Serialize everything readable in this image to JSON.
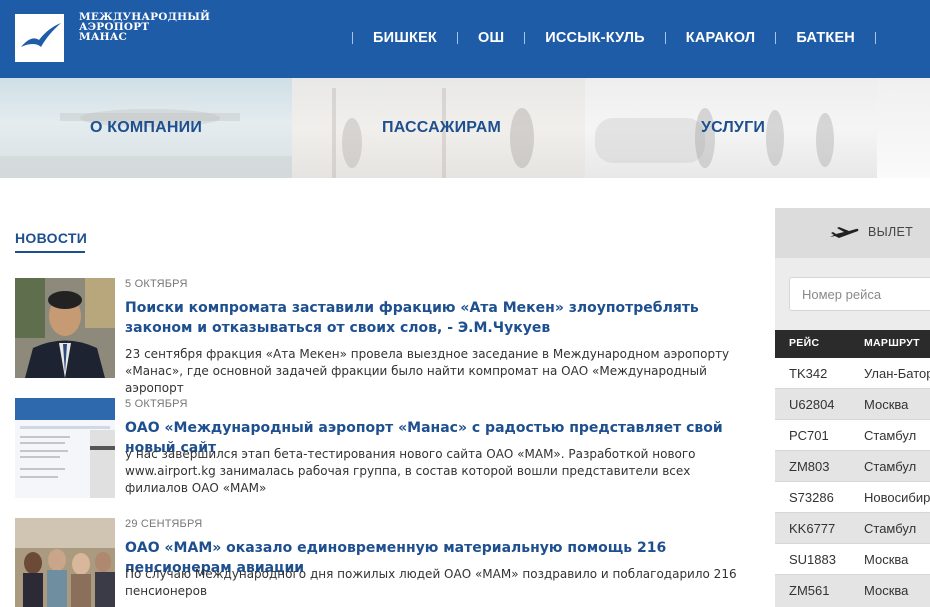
{
  "header": {
    "logo_lines": [
      "МЕЖДУНАРОДНЫЙ",
      "АЭРОПОРТ",
      "МАНАС"
    ],
    "nav": [
      "БИШКЕК",
      "ОШ",
      "ИССЫК-КУЛЬ",
      "КАРАКОЛ",
      "БАТКЕН"
    ],
    "bg_color": "#1f5ca8"
  },
  "banner": {
    "tiles": [
      "О КОМПАНИИ",
      "ПАССАЖИРАМ",
      "УСЛУГИ"
    ]
  },
  "news": {
    "title": "НОВОСТИ",
    "items": [
      {
        "date": "5 ОКТЯБРЯ",
        "headline": "Поиски компромата заставили фракцию «Ата Мекен» злоупотреблять законом и отказываться от своих слов, - Э.М.Чукуев",
        "summary": "23 сентября фракция «Ата Мекен» провела выездное заседание в Международном аэропорту «Манас», где основной задачей фракции было найти компромат на ОАО «Международный аэропорт"
      },
      {
        "date": "5 ОКТЯБРЯ",
        "headline": "ОАО «Международный аэропорт «Манас» с радостью представляет свой новый сайт",
        "summary": "у нас завершился этап бета-тестирования нового сайта ОАО «МАМ». Разработкой нового www.airport.kg занималась рабочая группа, в состав которой вошли представители всех филиалов ОАО «МАМ»"
      },
      {
        "date": "29 СЕНТЯБРЯ",
        "headline": "ОАО «МАМ» оказало единовременную материальную помощь 216 пенсионерам авиации",
        "summary": "По случаю Международного дня пожилых людей ОАО «МАМ» поздравило и поблагодарило 216 пенсионеров"
      }
    ]
  },
  "flights": {
    "tab_label": "ВЫЛЕТ",
    "search_placeholder": "Номер рейса",
    "columns": [
      "РЕЙС",
      "МАРШРУТ"
    ],
    "rows": [
      {
        "flight": "TK342",
        "route": "Улан-Батор"
      },
      {
        "flight": "U62804",
        "route": "Москва"
      },
      {
        "flight": "PC701",
        "route": "Стамбул"
      },
      {
        "flight": "ZM803",
        "route": "Стамбул"
      },
      {
        "flight": "S73286",
        "route": "Новосибирск"
      },
      {
        "flight": "KK6777",
        "route": "Стамбул"
      },
      {
        "flight": "SU1883",
        "route": "Москва"
      },
      {
        "flight": "ZM561",
        "route": "Москва"
      }
    ]
  }
}
